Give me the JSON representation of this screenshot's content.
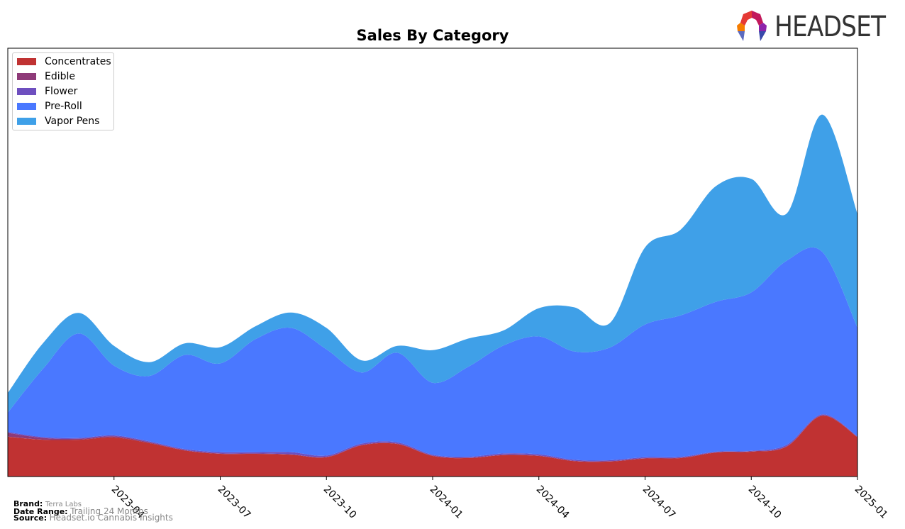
{
  "chart_data": {
    "type": "area",
    "stacked": true,
    "smooth": true,
    "title": "Sales By Category",
    "xlabel": "",
    "ylabel": "",
    "y_ticks_visible": false,
    "ylim": [
      0,
      100
    ],
    "x": [
      "2023-01",
      "2023-02",
      "2023-03",
      "2023-04",
      "2023-05",
      "2023-06",
      "2023-07",
      "2023-08",
      "2023-09",
      "2023-10",
      "2023-11",
      "2023-12",
      "2024-01",
      "2024-02",
      "2024-03",
      "2024-04",
      "2024-05",
      "2024-06",
      "2024-07",
      "2024-08",
      "2024-09",
      "2024-10",
      "2024-11",
      "2024-12",
      "2025-01"
    ],
    "x_tick_labels": [
      "2023-04",
      "2023-07",
      "2023-10",
      "2024-01",
      "2024-04",
      "2024-07",
      "2024-10",
      "2025-01"
    ],
    "x_tick_positions": [
      "2023-04",
      "2023-07",
      "2023-10",
      "2024-01",
      "2024-04",
      "2024-07",
      "2024-10",
      "2025-01"
    ],
    "legend_position": "top-left",
    "series": [
      {
        "name": "Concentrates",
        "color": "#c03232",
        "values": [
          9.3,
          8.6,
          8.6,
          9.1,
          7.8,
          6.1,
          5.3,
          5.3,
          5.1,
          4.5,
          7.3,
          7.6,
          4.8,
          4.3,
          5.0,
          4.8,
          3.6,
          3.5,
          4.2,
          4.3,
          5.6,
          5.8,
          7.0,
          14.2,
          9.2
        ]
      },
      {
        "name": "Edible",
        "color": "#8e3a78",
        "values": [
          0.9,
          0.4,
          0.2,
          0.3,
          0.2,
          0.1,
          0.1,
          0.1,
          0.1,
          0.1,
          0.1,
          0.1,
          0.1,
          0.1,
          0.1,
          0.1,
          0.1,
          0.1,
          0.1,
          0.1,
          0.1,
          0.1,
          0.1,
          0.1,
          0.1
        ]
      },
      {
        "name": "Flower",
        "color": "#6e4fbf",
        "values": [
          0.2,
          0.2,
          0.2,
          0.2,
          0.2,
          0.2,
          0.3,
          0.3,
          0.5,
          0.3,
          0.3,
          0.3,
          0.2,
          0.2,
          0.3,
          0.3,
          0.2,
          0.2,
          0.2,
          0.2,
          0.1,
          0.1,
          0.3,
          0.2,
          0.1
        ]
      },
      {
        "name": "Pre-Roll",
        "color": "#4a78ff",
        "values": [
          4.5,
          16.0,
          24.4,
          16.3,
          15.3,
          22.0,
          20.7,
          26.4,
          29.0,
          24.8,
          16.6,
          20.9,
          16.8,
          21.0,
          25.2,
          27.5,
          25.3,
          26.3,
          31.0,
          33.0,
          35.0,
          37.0,
          43.0,
          38.0,
          25.4
        ]
      },
      {
        "name": "Vapor Pens",
        "color": "#3fa0e8",
        "values": [
          4.6,
          6.0,
          4.8,
          4.6,
          3.2,
          2.7,
          3.8,
          3.0,
          3.6,
          5.0,
          2.8,
          1.6,
          7.6,
          6.6,
          3.5,
          6.6,
          10.3,
          5.7,
          18.0,
          20.0,
          27.0,
          26.5,
          11.0,
          32.0,
          26.5
        ]
      }
    ]
  },
  "logo": {
    "text": "HEADSET"
  },
  "footer": {
    "brand_key": "Brand:",
    "brand_val": "Terra Labs",
    "range_key": "Date Range:",
    "range_val": "Trailing 24 Months",
    "source_key": "Source:",
    "source_val": "Headset.io Cannabis Insights"
  }
}
